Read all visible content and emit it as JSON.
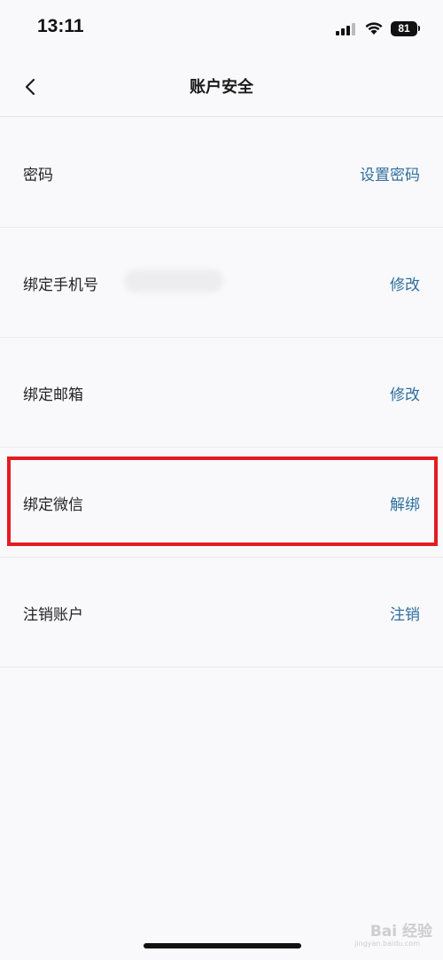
{
  "status_bar": {
    "time": "13:11",
    "battery": "81",
    "icons": [
      "signal-icon",
      "wifi-icon",
      "battery-icon"
    ]
  },
  "header": {
    "back_icon": "chevron-left-icon",
    "title": "账户安全"
  },
  "rows": [
    {
      "label": "密码",
      "action": "设置密码"
    },
    {
      "label": "绑定手机号",
      "action": "修改"
    },
    {
      "label": "绑定邮箱",
      "action": "修改"
    },
    {
      "label": "绑定微信",
      "action": "解绑"
    },
    {
      "label": "注销账户",
      "action": "注销"
    }
  ],
  "watermark": {
    "text": "Bai 经验",
    "sub": "jingyan.baidu.com"
  },
  "colors": {
    "background": "#f9f9fb",
    "action_text": "#2f6f9f",
    "highlight": "#e31c22"
  }
}
